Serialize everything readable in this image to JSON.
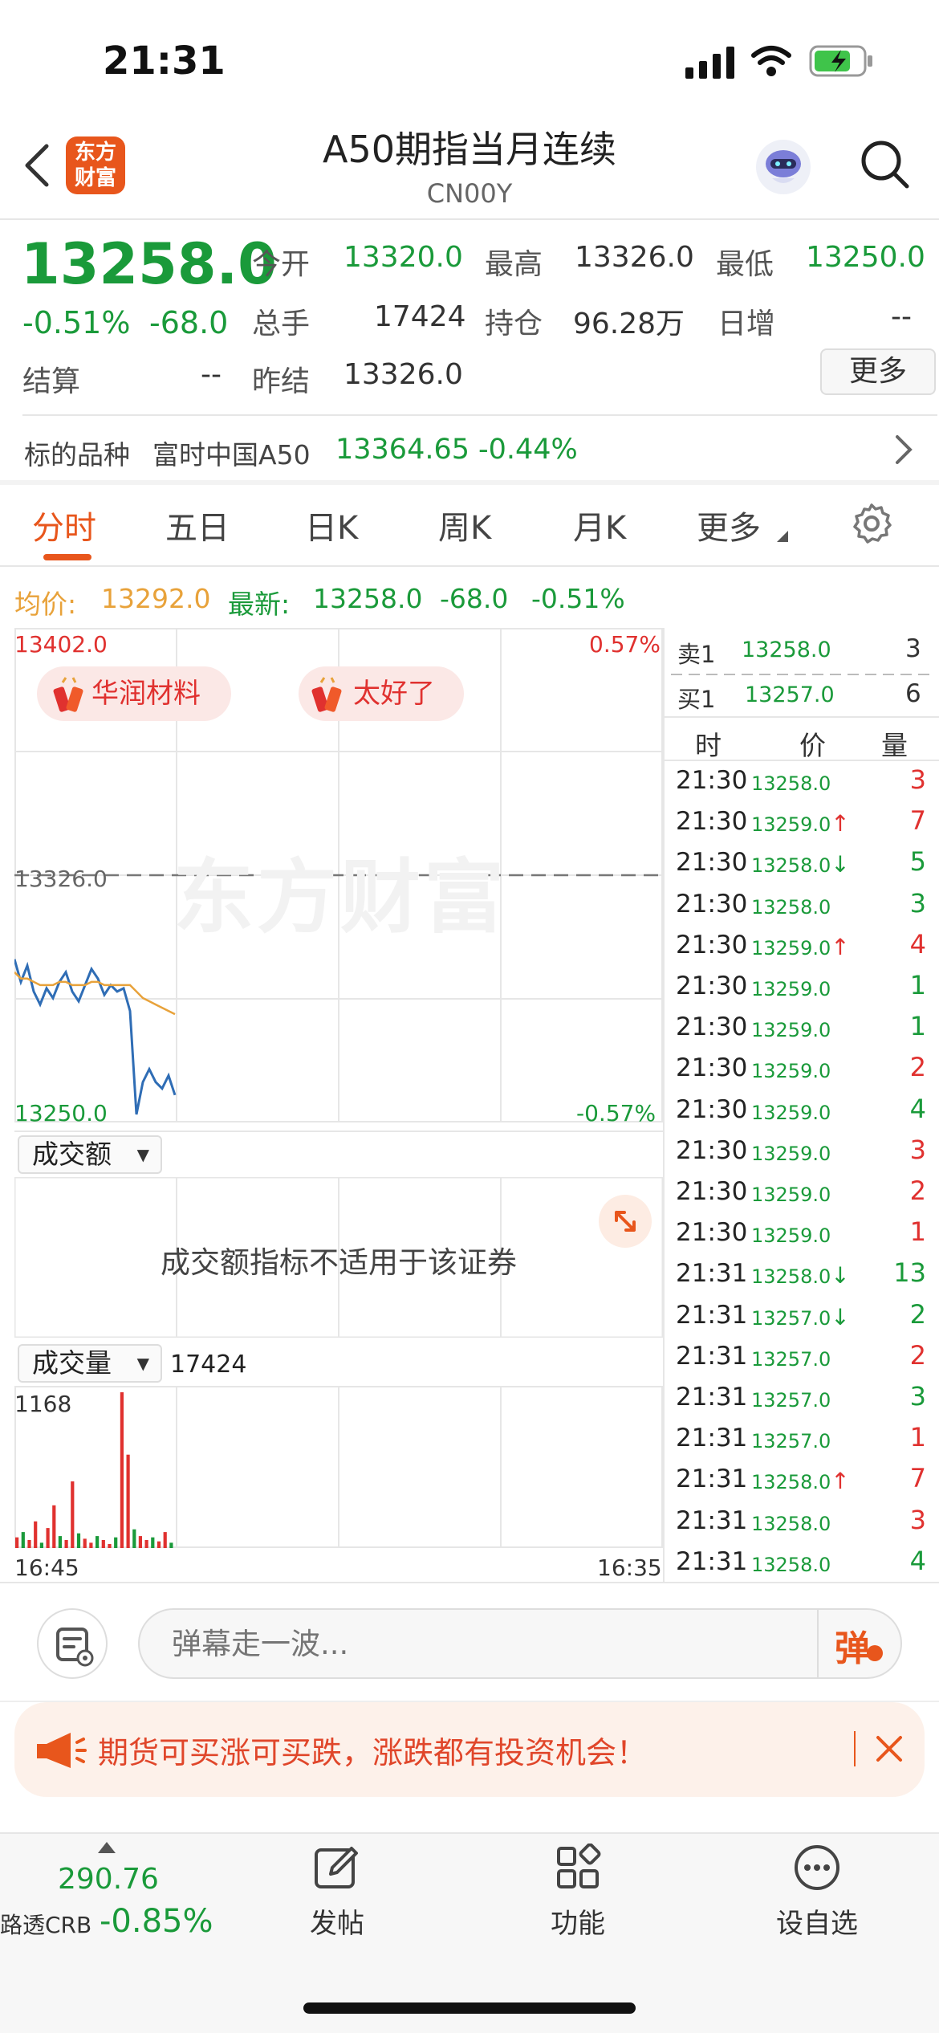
{
  "status": {
    "time": "21:31"
  },
  "header": {
    "logo_line1": "东方",
    "logo_line2": "财富",
    "title": "A50期指当月连续",
    "code": "CN00Y"
  },
  "quote": {
    "price": "13258.0",
    "change_pct": "-0.51%",
    "change": "-68.0",
    "open_label": "今开",
    "open": "13320.0",
    "high_label": "最高",
    "high": "13326.0",
    "low_label": "最低",
    "low": "13250.0",
    "volume_label": "总手",
    "volume": "17424",
    "oi_label": "持仓",
    "oi": "96.28万",
    "daily_inc_label": "日增",
    "daily_inc": "--",
    "settle_label": "结算",
    "settle": "--",
    "prev_settle_label": "昨结",
    "prev_settle": "13326.0",
    "more_button": "更多"
  },
  "underlying": {
    "label": "标的品种",
    "name": "富时中国A50",
    "price": "13364.65",
    "change_pct": "-0.44%"
  },
  "tabs": [
    "分时",
    "五日",
    "日K",
    "周K",
    "月K",
    "更多"
  ],
  "chart_info": {
    "avg_label": "均价:",
    "avg": "13292.0",
    "last_label": "最新:",
    "last": "13258.0",
    "last_change": "-68.0",
    "last_pct": "-0.51%"
  },
  "chart_data": [
    {
      "type": "line",
      "series": [
        {
          "name": "",
          "values": [
            13300,
            13293,
            13298,
            13290,
            13286,
            13291,
            13288,
            13293,
            13296,
            13290,
            13287,
            13292,
            13297,
            13294,
            13289,
            13292,
            13290,
            13291,
            13284,
            13252,
            13262,
            13266,
            13262,
            13260,
            13264,
            13258
          ]
        },
        {
          "name": "",
          "values": [
            13296,
            13294,
            13294,
            13293,
            13292,
            13292,
            13292,
            13293,
            13293,
            13292,
            13292,
            13292,
            13293,
            13293,
            13292,
            13292,
            13292,
            13292,
            13292,
            13290,
            13288,
            13287,
            13286,
            13285,
            13284,
            13283
          ]
        }
      ],
      "ylim": [
        13250.0,
        13402.0
      ],
      "y_max_label": "13402.0",
      "y_min_label": "13250.0",
      "y_max_pct": "0.57%",
      "y_min_pct": "-0.57%",
      "prev_settle_line": "13326.0",
      "x_start_label": "16:45",
      "x_end_label": "16:35"
    },
    {
      "type": "bar",
      "values": [
        80,
        120,
        60,
        200,
        40,
        150,
        320,
        90,
        60,
        500,
        110,
        70,
        40,
        90,
        60,
        30,
        80,
        1168,
        700,
        140,
        90,
        60,
        80,
        50,
        120,
        40
      ],
      "ylim": [
        0,
        1168
      ],
      "y_max_label": "1168"
    }
  ],
  "badges": [
    "华润材料",
    "太好了"
  ],
  "watermark": "东方财富",
  "turnover": {
    "selector": "成交额",
    "message": "成交额指标不适用于该证券"
  },
  "volume": {
    "selector": "成交量",
    "value": "17424"
  },
  "orderbook": {
    "sell_label": "卖1",
    "sell_price": "13258.0",
    "sell_vol": "3",
    "buy_label": "买1",
    "buy_price": "13257.0",
    "buy_vol": "6",
    "col_time": "时",
    "col_price": "价",
    "col_vol": "量"
  },
  "ticks": [
    {
      "time": "21:30",
      "price": "13258.0",
      "arrow": "",
      "vol": "3",
      "pcolor": "green",
      "vcolor": "red"
    },
    {
      "time": "21:30",
      "price": "13259.0",
      "arrow": "↑",
      "vol": "7",
      "pcolor": "green",
      "vcolor": "red"
    },
    {
      "time": "21:30",
      "price": "13258.0",
      "arrow": "↓",
      "vol": "5",
      "pcolor": "green",
      "vcolor": "green"
    },
    {
      "time": "21:30",
      "price": "13258.0",
      "arrow": "",
      "vol": "3",
      "pcolor": "green",
      "vcolor": "green"
    },
    {
      "time": "21:30",
      "price": "13259.0",
      "arrow": "↑",
      "vol": "4",
      "pcolor": "green",
      "vcolor": "red"
    },
    {
      "time": "21:30",
      "price": "13259.0",
      "arrow": "",
      "vol": "1",
      "pcolor": "green",
      "vcolor": "green"
    },
    {
      "time": "21:30",
      "price": "13259.0",
      "arrow": "",
      "vol": "1",
      "pcolor": "green",
      "vcolor": "green"
    },
    {
      "time": "21:30",
      "price": "13259.0",
      "arrow": "",
      "vol": "2",
      "pcolor": "green",
      "vcolor": "red"
    },
    {
      "time": "21:30",
      "price": "13259.0",
      "arrow": "",
      "vol": "4",
      "pcolor": "green",
      "vcolor": "green"
    },
    {
      "time": "21:30",
      "price": "13259.0",
      "arrow": "",
      "vol": "3",
      "pcolor": "green",
      "vcolor": "red"
    },
    {
      "time": "21:30",
      "price": "13259.0",
      "arrow": "",
      "vol": "2",
      "pcolor": "green",
      "vcolor": "red"
    },
    {
      "time": "21:30",
      "price": "13259.0",
      "arrow": "",
      "vol": "1",
      "pcolor": "green",
      "vcolor": "red"
    },
    {
      "time": "21:31",
      "price": "13258.0",
      "arrow": "↓",
      "vol": "13",
      "pcolor": "green",
      "vcolor": "green"
    },
    {
      "time": "21:31",
      "price": "13257.0",
      "arrow": "↓",
      "vol": "2",
      "pcolor": "green",
      "vcolor": "green"
    },
    {
      "time": "21:31",
      "price": "13257.0",
      "arrow": "",
      "vol": "2",
      "pcolor": "green",
      "vcolor": "red"
    },
    {
      "time": "21:31",
      "price": "13257.0",
      "arrow": "",
      "vol": "3",
      "pcolor": "green",
      "vcolor": "green"
    },
    {
      "time": "21:31",
      "price": "13257.0",
      "arrow": "",
      "vol": "1",
      "pcolor": "green",
      "vcolor": "red"
    },
    {
      "time": "21:31",
      "price": "13258.0",
      "arrow": "↑",
      "vol": "7",
      "pcolor": "green",
      "vcolor": "red"
    },
    {
      "time": "21:31",
      "price": "13258.0",
      "arrow": "",
      "vol": "3",
      "pcolor": "green",
      "vcolor": "red"
    },
    {
      "time": "21:31",
      "price": "13258.0",
      "arrow": "",
      "vol": "4",
      "pcolor": "green",
      "vcolor": "green"
    }
  ],
  "comment": {
    "placeholder": "弹幕走一波...",
    "send_button": "弹"
  },
  "banner": {
    "text": "期货可买涨可买跌，涨跌都有投资机会！"
  },
  "bottom_nav": {
    "index_value": "290.76",
    "index_name": "路透CRB",
    "index_pct": "-0.85%",
    "post": "发帖",
    "functions": "功能",
    "watchlist": "设自选"
  },
  "colors": {
    "accent": "#e8561c",
    "up": "#e0312f",
    "down": "#1a9a3a",
    "avg_line": "#e8a23a",
    "price_line": "#2f6db5"
  }
}
